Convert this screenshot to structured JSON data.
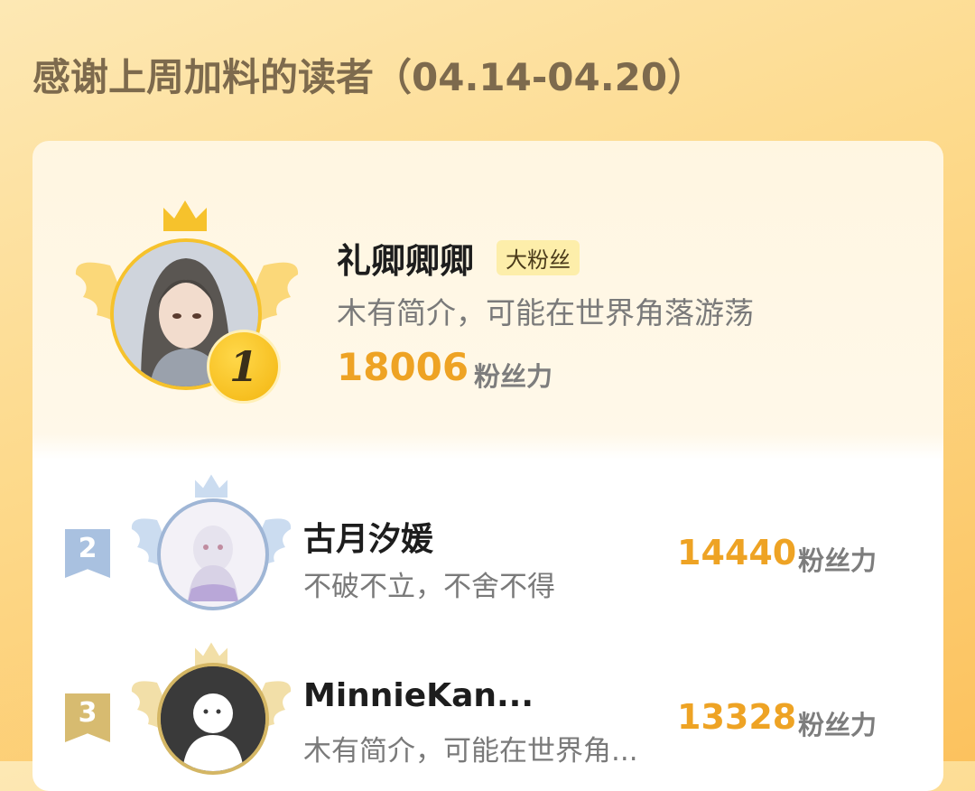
{
  "title": "感谢上周加料的读者（04.14-04.20）",
  "ranking": [
    {
      "rank": "1",
      "name": "礼卿卿卿",
      "tag": "大粉丝",
      "bio": "木有简介，可能在世界角落游荡",
      "score": "18006",
      "unit": "粉丝力"
    },
    {
      "rank": "2",
      "name": "古月汐媛",
      "bio": "不破不立，不舍不得",
      "score": "14440",
      "unit": "粉丝力"
    },
    {
      "rank": "3",
      "name": "MinnieKan...",
      "bio": "木有简介，可能在世界角...",
      "score": "13328",
      "unit": "粉丝力"
    }
  ],
  "colors": {
    "gold": "#f6c22c",
    "score": "#eea324",
    "silver": "#9fb6d6",
    "bronze": "#d4b664"
  }
}
